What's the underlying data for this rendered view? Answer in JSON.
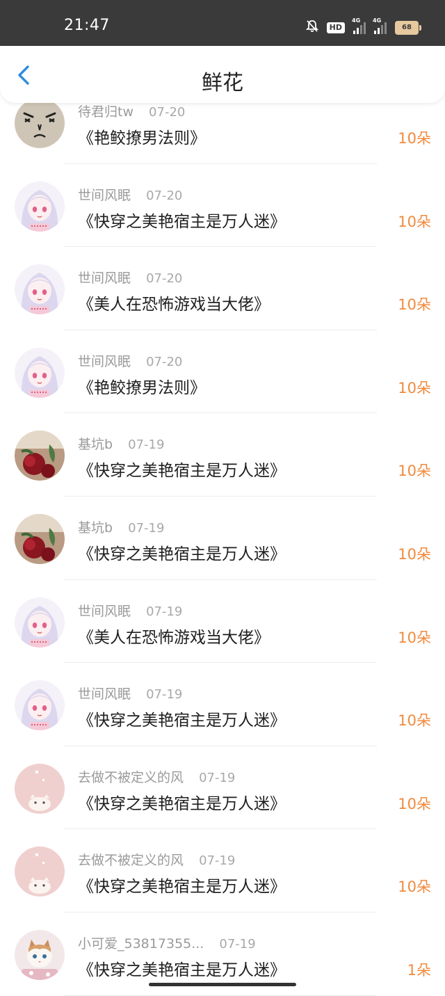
{
  "status_bar": {
    "time": "21:47",
    "hd_label": "HD",
    "network_1": "4G",
    "network_2": "4G",
    "battery": "68"
  },
  "header": {
    "title": "鲜花",
    "back_icon": "chevron-left-icon"
  },
  "colors": {
    "accent_orange": "#f08a3c",
    "back_blue": "#2f8be0",
    "status_bar_bg": "#3a3a3a"
  },
  "records": [
    {
      "user": "待君归tw",
      "date": "07-20",
      "book": "《艳鲛撩男法则》",
      "amount": "10朵",
      "avatar": "angry-face-avatar"
    },
    {
      "user": "世间风眠",
      "date": "07-20",
      "book": "《快穿之美艳宿主是万人迷》",
      "amount": "10朵",
      "avatar": "anime-girl-avatar"
    },
    {
      "user": "世间风眠",
      "date": "07-20",
      "book": "《美人在恐怖游戏当大佬》",
      "amount": "10朵",
      "avatar": "anime-girl-avatar"
    },
    {
      "user": "世间风眠",
      "date": "07-20",
      "book": "《艳鲛撩男法则》",
      "amount": "10朵",
      "avatar": "anime-girl-avatar"
    },
    {
      "user": "基坑b",
      "date": "07-19",
      "book": "《快穿之美艳宿主是万人迷》",
      "amount": "10朵",
      "avatar": "rose-avatar"
    },
    {
      "user": "基坑b",
      "date": "07-19",
      "book": "《快穿之美艳宿主是万人迷》",
      "amount": "10朵",
      "avatar": "rose-avatar"
    },
    {
      "user": "世间风眠",
      "date": "07-19",
      "book": "《美人在恐怖游戏当大佬》",
      "amount": "10朵",
      "avatar": "anime-girl-avatar"
    },
    {
      "user": "世间风眠",
      "date": "07-19",
      "book": "《快穿之美艳宿主是万人迷》",
      "amount": "10朵",
      "avatar": "anime-girl-avatar"
    },
    {
      "user": "去做不被定义的风",
      "date": "07-19",
      "book": "《快穿之美艳宿主是万人迷》",
      "amount": "10朵",
      "avatar": "pink-cat-avatar"
    },
    {
      "user": "去做不被定义的风",
      "date": "07-19",
      "book": "《快穿之美艳宿主是万人迷》",
      "amount": "10朵",
      "avatar": "pink-cat-avatar"
    },
    {
      "user": "小可爱_53817355...",
      "date": "07-19",
      "book": "《快穿之美艳宿主是万人迷》",
      "amount": "1朵",
      "avatar": "kitten-avatar"
    }
  ]
}
